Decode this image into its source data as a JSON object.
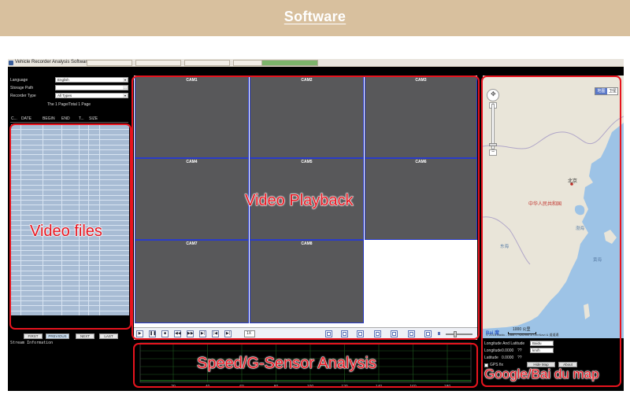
{
  "banner": {
    "title": "Software"
  },
  "app": {
    "window_title": "Vehicle Recorder Analysis Software",
    "form": {
      "language_label": "Language",
      "language_value": "English",
      "storage_label": "Storage Path",
      "storage_value": "",
      "recorder_label": "Recorder Type",
      "recorder_value": "All Types"
    },
    "page_info": "The    1 Page/Total 1 Page",
    "columns": [
      "C...",
      "DATE",
      "BEGIN",
      "END",
      "T...",
      "SIZE"
    ],
    "pager": [
      "FIRST",
      "PREVIOUS",
      "NEXT",
      "LAST"
    ],
    "stream_label": "Stream Information",
    "cameras": [
      "CAM1",
      "CAM2",
      "CAM3",
      "CAM4",
      "CAM5",
      "CAM6",
      "CAM7",
      "CAM8"
    ],
    "speed_value": "1X",
    "chart_ticks": [
      "20",
      "40",
      "60",
      "80",
      "100",
      "120",
      "140",
      "160",
      "180"
    ],
    "map": {
      "type_a": "地图",
      "type_b": "卫星",
      "city_beijing": "北京",
      "country_china": "中华人民共和国",
      "sea_bohai": "渤海",
      "sea_yellow": "黄海",
      "sea_east": "东海",
      "scale": "1000 公里",
      "copyright": "© 2015 Baidu - Data © NavInfo & CenNavi & 道道通",
      "logo": "Bai 度"
    },
    "map_controls": {
      "lnglat_label": "Longitude And Latitude",
      "map_select": "Baidu",
      "longitude_label": "Longitude",
      "longitude_value": "0.0000",
      "longitude_unit": "??",
      "unit_select": "km/h",
      "latitude_label": "Latitude",
      "latitude_value": "0.0000",
      "latitude_unit": "??",
      "gps_label": "GPS fix",
      "hide_map_btn": "Hide Map",
      "about_btn": "About"
    }
  },
  "overlays": {
    "video_files": "Video files",
    "video_playback": "Video Playback",
    "speed_analysis": "Speed/G-Sensor Analysis",
    "map": "Google/Bai du map"
  }
}
